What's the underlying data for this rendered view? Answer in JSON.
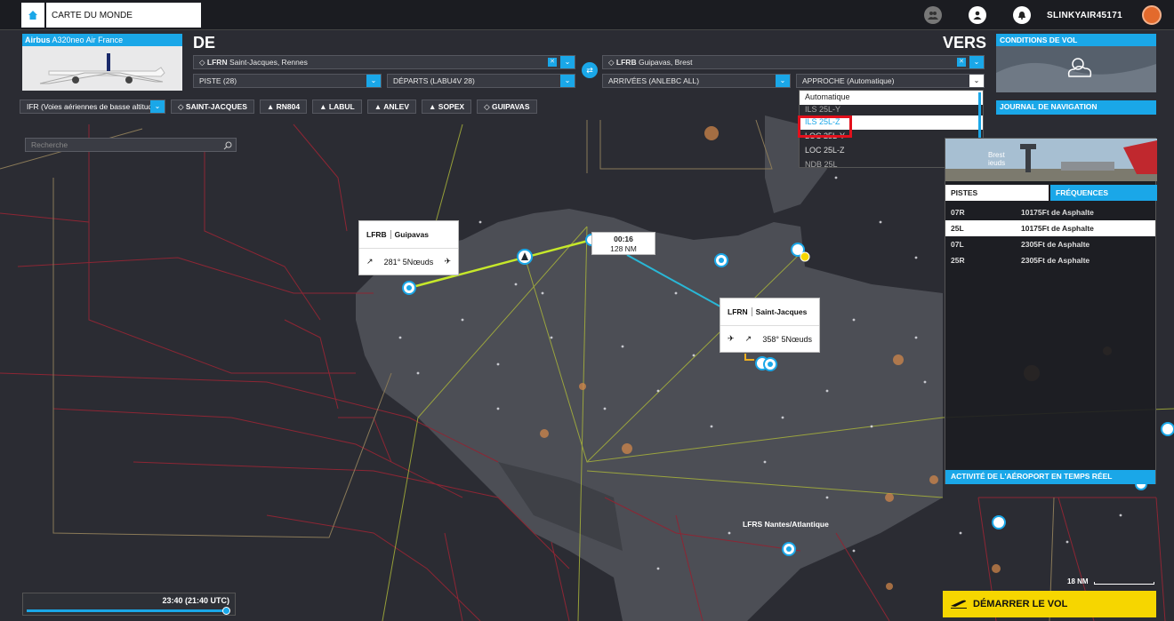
{
  "topbar": {
    "home_icon": "home-icon",
    "tab_label": "CARTE DU MONDE",
    "username": "SLINKYAIR45171"
  },
  "aircraft": {
    "brand": "Airbus",
    "model": "A320neo Air France"
  },
  "departure": {
    "heading": "DE",
    "airport_code": "LFRN",
    "airport_name": "Saint-Jacques, Rennes",
    "runway": "PISTE (28)",
    "procedure": "DÉPARTS (LABU4V 28)"
  },
  "arrival": {
    "heading": "VERS",
    "airport_code": "LFRB",
    "airport_name": "Guipavas, Brest",
    "procedure": "ARRIVÉES (ANLEBC ALL)",
    "approach": "APPROCHE (Automatique)"
  },
  "approach_dropdown": {
    "options": [
      "Automatique",
      "ILS 25L-Y",
      "ILS 25L-Z",
      "LOC 25L-Y",
      "LOC 25L-Z",
      "NDB 25L"
    ],
    "selected": "ILS 25L-Z"
  },
  "conditions": {
    "title": "CONDITIONS DE VOL"
  },
  "route": {
    "mode": "IFR (Voies aériennes de basse altitude)",
    "waypoints": [
      "SAINT-JACQUES",
      "RN804",
      "LABUL",
      "ANLEV",
      "SOPEX",
      "GUIPAVAS"
    ]
  },
  "journal": "JOURNAL DE NAVIGATION",
  "search": {
    "placeholder": "Recherche"
  },
  "airport_panel": {
    "photo_caption": "Brest\nieuds",
    "tabs": [
      "PISTES",
      "FRÉQUENCES"
    ],
    "runways": [
      {
        "id": "07R",
        "desc": "10175Ft de Asphalte"
      },
      {
        "id": "25L",
        "desc": "10175Ft de Asphalte"
      },
      {
        "id": "07L",
        "desc": "2305Ft de Asphalte"
      },
      {
        "id": "25R",
        "desc": "2305Ft de Asphalte"
      }
    ],
    "activity": "ACTIVITÉ DE L'AÉROPORT EN TEMPS RÉEL"
  },
  "map": {
    "tag_brest": {
      "code": "LFRB",
      "name": "Guipavas",
      "wind": "281° 5Nœuds"
    },
    "tag_rennes": {
      "code": "LFRN",
      "name": "Saint-Jacques",
      "wind": "358° 5Nœuds"
    },
    "leg": {
      "time": "00:16",
      "distance": "128 NM"
    },
    "nantes": {
      "code": "LFRS",
      "name": "Nantes/Atlantique"
    },
    "scale": "18 NM"
  },
  "time": {
    "label": "23:40 (21:40 UTC)",
    "progress": 0.97
  },
  "start_button": "DÉMARRER LE VOL",
  "colors": {
    "accent": "#1aa7e8",
    "route_brest": "#c6e82a",
    "route_rennes": "#29b7d6",
    "start": "#f6d600",
    "highlight": "#e2101c"
  }
}
